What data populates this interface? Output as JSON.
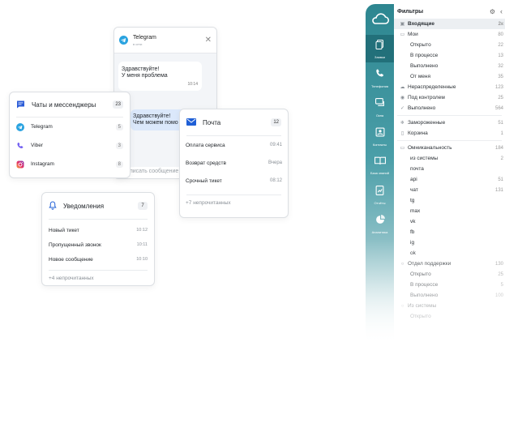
{
  "telegram_chat": {
    "name": "Telegram",
    "status": "в сети",
    "incoming_line1": "Здравствуйте!",
    "incoming_line2": "У меня проблема",
    "incoming_time": "10:14",
    "outgoing_line1": "Здравствуйте!",
    "outgoing_line2": "Чем можем помо",
    "compose_placeholder": "Написать сообщение"
  },
  "chats_card": {
    "title": "Чаты и мессенджеры",
    "count": "23",
    "items": [
      {
        "label": "Telegram",
        "count": "5"
      },
      {
        "label": "Viber",
        "count": "3"
      },
      {
        "label": "Instagram",
        "count": "8"
      }
    ]
  },
  "mail_card": {
    "title": "Почта",
    "count": "12",
    "items": [
      {
        "label": "Оплата сервиса",
        "time": "09:41"
      },
      {
        "label": "Возврат средств",
        "time": "Вчера"
      },
      {
        "label": "Срочный тикет",
        "time": "08:12"
      }
    ],
    "more": "+7 непрочитанных"
  },
  "notifications_card": {
    "title": "Уведомления",
    "count": "7",
    "items": [
      {
        "label": "Новый тикет",
        "time": "10:12"
      },
      {
        "label": "Пропущенный звонок",
        "time": "10:11"
      },
      {
        "label": "Новое сообщение",
        "time": "10:10"
      }
    ],
    "more": "+4 непрочитанных"
  },
  "rail": {
    "items": [
      {
        "label": "Заявки"
      },
      {
        "label": "Телефония"
      },
      {
        "label": "Окна"
      },
      {
        "label": "Контакты"
      },
      {
        "label": "База знаний"
      },
      {
        "label": "Отчёты"
      },
      {
        "label": "Аналитика"
      }
    ]
  },
  "filters": {
    "title": "Фильтры",
    "rows": [
      {
        "label": "Входящие",
        "count": "2к",
        "icon": "inbox-icon",
        "sel": true
      },
      {
        "label": "Мои",
        "count": "80",
        "icon": "folder-icon"
      },
      {
        "label": "Открыто",
        "count": "22",
        "sub": true
      },
      {
        "label": "В процессе",
        "count": "13",
        "sub": true
      },
      {
        "label": "Выполнено",
        "count": "32",
        "sub": true
      },
      {
        "label": "От меня",
        "count": "35",
        "sub": true
      },
      {
        "label": "Нераспределенные",
        "count": "123",
        "icon": "cloud-icon"
      },
      {
        "label": "Под контролем",
        "count": "25",
        "icon": "eye-icon"
      },
      {
        "label": "Выполнено",
        "count": "564",
        "icon": "check-icon"
      },
      {
        "sep": true
      },
      {
        "label": "Замороженные",
        "count": "51",
        "icon": "snowflake-icon"
      },
      {
        "label": "Корзина",
        "count": "1",
        "icon": "trash-icon"
      },
      {
        "sep": true
      },
      {
        "label": "Омниканальность",
        "count": "184",
        "icon": "folder-icon"
      },
      {
        "label": "из системы",
        "count": "2",
        "sub": true
      },
      {
        "label": "почта",
        "count": "",
        "sub": true
      },
      {
        "label": "api",
        "count": "51",
        "sub": true
      },
      {
        "label": "чат",
        "count": "131",
        "sub": true
      },
      {
        "label": "tg",
        "count": "",
        "sub": true
      },
      {
        "label": "max",
        "count": "",
        "sub": true
      },
      {
        "label": "vk",
        "count": "",
        "sub": true
      },
      {
        "label": "fb",
        "count": "",
        "sub": true
      },
      {
        "label": "ig",
        "count": "",
        "sub": true
      },
      {
        "label": "ok",
        "count": "",
        "sub": true
      },
      {
        "label": "Отдел поддержки",
        "count": "130",
        "icon": "circle-icon"
      },
      {
        "label": "Открыто",
        "count": "25",
        "sub": true
      },
      {
        "label": "В процессе",
        "count": "5",
        "sub": true
      },
      {
        "label": "Выполнено",
        "count": "100",
        "sub": true
      },
      {
        "label": "Из системы",
        "count": "",
        "icon": "circle-icon"
      },
      {
        "label": "Открыто",
        "count": "",
        "sub": true
      }
    ]
  },
  "colors": {
    "accent": "#2d8690",
    "mail_icon": "#1f5fd6",
    "chat_icon": "#2a5bd7",
    "telegram": "#2aa3e0"
  }
}
